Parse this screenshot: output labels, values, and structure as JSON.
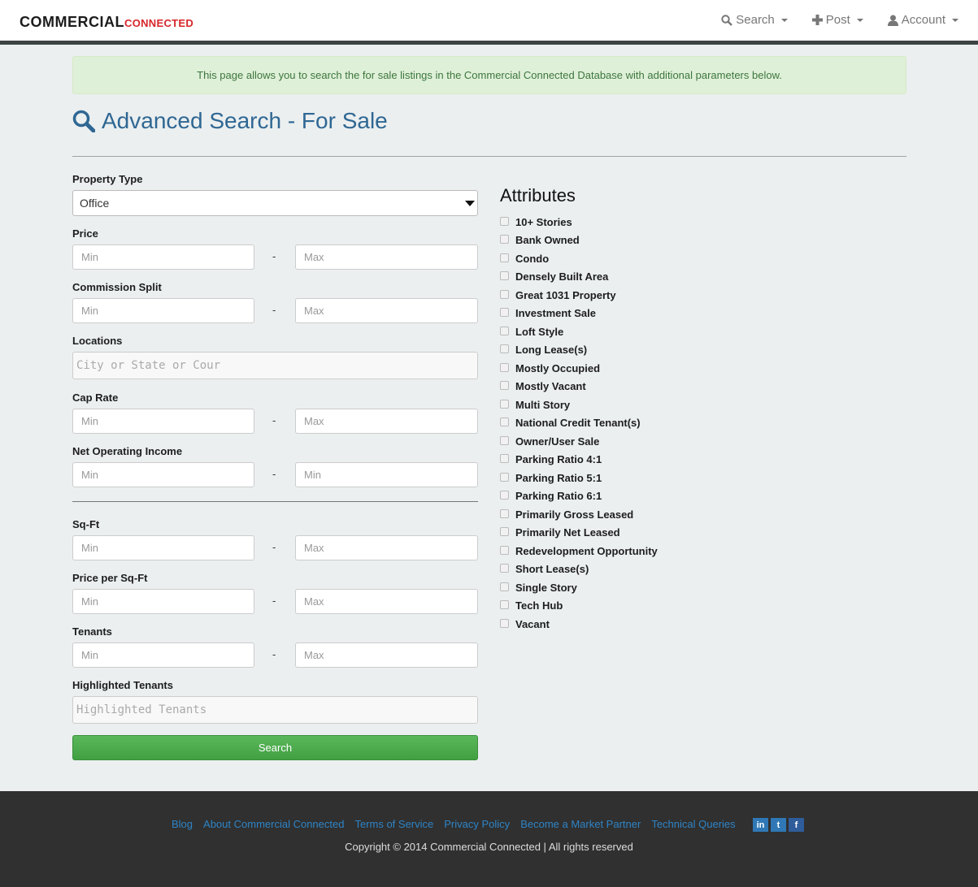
{
  "brand": {
    "part1": "COMMERCIAL",
    "part2": "CONNECTED"
  },
  "nav": [
    {
      "label": "Search",
      "icon": "search-icon"
    },
    {
      "label": "Post",
      "icon": "plus-icon"
    },
    {
      "label": "Account",
      "icon": "user-icon"
    }
  ],
  "alert": "This page allows you to search the for sale listings in the Commercial Connected Database with additional parameters below.",
  "page_title": "Advanced Search - For Sale",
  "form": {
    "property_type_label": "Property Type",
    "property_type_value": "Office",
    "price_label": "Price",
    "commission_label": "Commission Split",
    "locations_label": "Locations",
    "locations_placeholder": "City or State or Cour",
    "cap_rate_label": "Cap Rate",
    "noi_label": "Net Operating Income",
    "sqft_label": "Sq-Ft",
    "price_sqft_label": "Price per Sq-Ft",
    "tenants_label": "Tenants",
    "highlighted_label": "Highlighted Tenants",
    "highlighted_placeholder": "Highlighted Tenants",
    "min": "Min",
    "max": "Max",
    "dash": "-",
    "search_button": "Search"
  },
  "attributes": {
    "title": "Attributes",
    "items": [
      "10+ Stories",
      "Bank Owned",
      "Condo",
      "Densely Built Area",
      "Great 1031 Property",
      "Investment Sale",
      "Loft Style",
      "Long Lease(s)",
      "Mostly Occupied",
      "Mostly Vacant",
      "Multi Story",
      "National Credit Tenant(s)",
      "Owner/User Sale",
      "Parking Ratio 4:1",
      "Parking Ratio 5:1",
      "Parking Ratio 6:1",
      "Primarily Gross Leased",
      "Primarily Net Leased",
      "Redevelopment Opportunity",
      "Short Lease(s)",
      "Single Story",
      "Tech Hub",
      "Vacant"
    ]
  },
  "footer": {
    "links": [
      "Blog",
      "About Commercial Connected",
      "Terms of Service",
      "Privacy Policy",
      "Become a Market Partner",
      "Technical Queries"
    ],
    "social": [
      {
        "name": "linkedin",
        "glyph": "in",
        "color": "#2f78b5"
      },
      {
        "name": "twitter",
        "glyph": "t",
        "color": "#2f78b5"
      },
      {
        "name": "facebook",
        "glyph": "f",
        "color": "#2f5c9a"
      }
    ],
    "copyright": "Copyright © 2014 Commercial Connected | All rights reserved"
  }
}
